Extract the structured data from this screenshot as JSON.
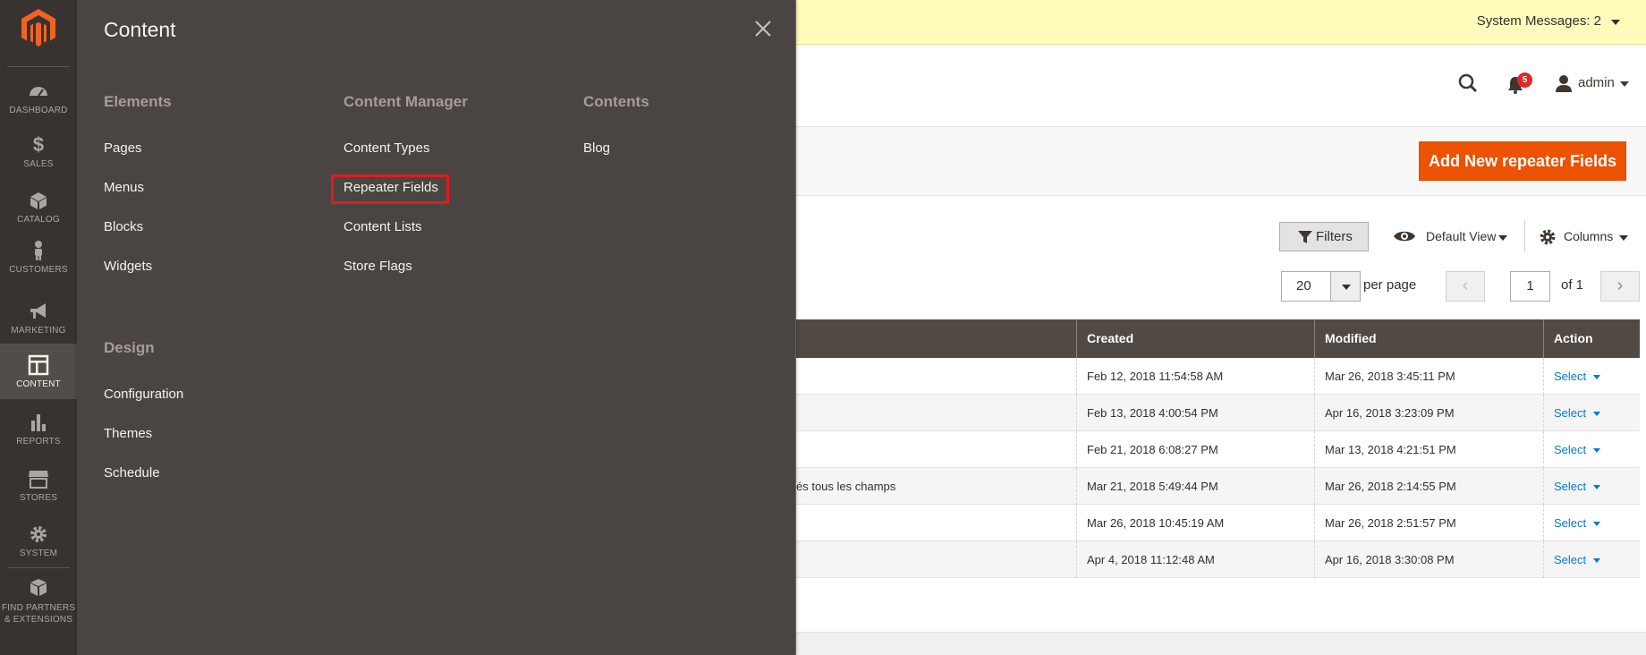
{
  "sidebar": {
    "logo": "magento-logo",
    "items": [
      {
        "label": "DASHBOARD",
        "icon": "dashboard-icon"
      },
      {
        "label": "SALES",
        "icon": "dollar-icon"
      },
      {
        "label": "CATALOG",
        "icon": "cube-icon"
      },
      {
        "label": "CUSTOMERS",
        "icon": "person-icon"
      },
      {
        "label": "MARKETING",
        "icon": "megaphone-icon"
      },
      {
        "label": "CONTENT",
        "icon": "layout-icon",
        "active": true
      },
      {
        "label": "REPORTS",
        "icon": "bar-chart-icon"
      },
      {
        "label": "STORES",
        "icon": "storefront-icon"
      },
      {
        "label": "SYSTEM",
        "icon": "gear-icon"
      },
      {
        "label": "FIND PARTNERS",
        "label2": "& EXTENSIONS",
        "icon": "boxes-icon"
      }
    ]
  },
  "system_messages": {
    "label": "System Messages: 2"
  },
  "header": {
    "notifications_count": "5",
    "user": "admin"
  },
  "actions": {
    "add_button": "Add New repeater Fields"
  },
  "toolbar": {
    "filters": "Filters",
    "view": "Default View",
    "columns": "Columns",
    "per_page_value": "20",
    "per_page_label": "per page",
    "page_value": "1",
    "page_of": "of 1",
    "prev": "‹",
    "next": "›"
  },
  "grid": {
    "headers": [
      "Created",
      "Modified",
      "Action"
    ],
    "rows": [
      {
        "title": "",
        "created": "Feb 12, 2018 11:54:58 AM",
        "modified": "Mar 26, 2018 3:45:11 PM",
        "action": "Select"
      },
      {
        "title": "",
        "created": "Feb 13, 2018 4:00:54 PM",
        "modified": "Apr 16, 2018 3:23:09 PM",
        "action": "Select"
      },
      {
        "title": "",
        "created": "Feb 21, 2018 6:08:27 PM",
        "modified": "Mar 13, 2018 4:21:51 PM",
        "action": "Select"
      },
      {
        "title": "és tous les champs",
        "created": "Mar 21, 2018 5:49:44 PM",
        "modified": "Mar 26, 2018 2:14:55 PM",
        "action": "Select"
      },
      {
        "title": "",
        "created": "Mar 26, 2018 10:45:19 AM",
        "modified": "Mar 26, 2018 2:51:57 PM",
        "action": "Select"
      },
      {
        "title": "",
        "created": "Apr 4, 2018 11:12:48 AM",
        "modified": "Apr 16, 2018 3:30:08 PM",
        "action": "Select"
      }
    ]
  },
  "flyout": {
    "title": "Content",
    "sections": {
      "elements": {
        "title": "Elements",
        "items": [
          "Pages",
          "Menus",
          "Blocks",
          "Widgets"
        ]
      },
      "content_manager": {
        "title": "Content Manager",
        "items": [
          "Content Types",
          "Repeater Fields",
          "Content Lists",
          "Store Flags"
        ]
      },
      "contents": {
        "title": "Contents",
        "items": [
          "Blog"
        ]
      },
      "design": {
        "title": "Design",
        "items": [
          "Configuration",
          "Themes",
          "Schedule"
        ]
      }
    },
    "highlighted_item": "Repeater Fields"
  },
  "colors": {
    "accent": "#eb5202",
    "sidebar": "#373330",
    "flyout": "#4a4542",
    "grid_header": "#514943",
    "highlight": "#e21a1a",
    "link": "#007bdb"
  }
}
